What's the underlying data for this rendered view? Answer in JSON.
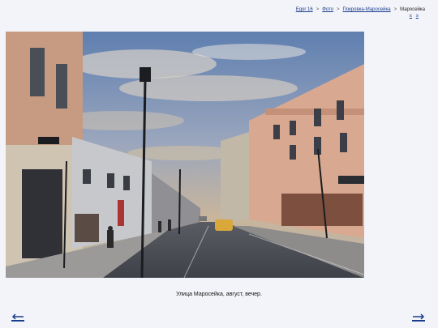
{
  "breadcrumb": {
    "items": [
      "Egor 16",
      "Фото",
      "Покровка-Маросейка",
      "Маросейка"
    ],
    "separator": ">"
  },
  "subnav": {
    "prev": "≤",
    "next": "≥"
  },
  "photo": {
    "caption": "Улица Маросейка, август, вечер."
  },
  "nav": {
    "prev_icon": "arrow-left-icon",
    "next_icon": "arrow-right-icon"
  }
}
